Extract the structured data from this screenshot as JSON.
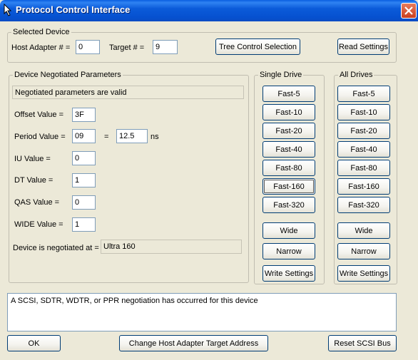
{
  "window": {
    "title": "Protocol Control Interface",
    "close_icon": "close-icon",
    "app_icon": "app-icon"
  },
  "selected_device": {
    "legend": "Selected Device",
    "host_adapter_label": "Host Adapter # =",
    "host_adapter_value": "0",
    "target_label": "Target # =",
    "target_value": "9",
    "tree_control_button": "Tree Control Selection",
    "read_settings_button": "Read Settings"
  },
  "negotiated": {
    "legend": "Device Negotiated Parameters",
    "status": "Negotiated parameters are valid",
    "offset_label": "Offset Value =",
    "offset_value": "3F",
    "period_label": "Period Value =",
    "period_value": "09",
    "period_equals": "=",
    "period_ns_value": "12.5",
    "period_unit": "ns",
    "iu_label": "IU Value =",
    "iu_value": "0",
    "dt_label": "DT Value =",
    "dt_value": "1",
    "qas_label": "QAS Value =",
    "qas_value": "0",
    "wide_label": "WIDE Value =",
    "wide_value": "1",
    "negotiated_at_label": "Device is negotiated at =",
    "negotiated_at_value": "Ultra 160"
  },
  "single_drive": {
    "legend": "Single Drive",
    "speeds": [
      "Fast-5",
      "Fast-10",
      "Fast-20",
      "Fast-40",
      "Fast-80",
      "Fast-160",
      "Fast-320"
    ],
    "wide": "Wide",
    "narrow": "Narrow",
    "write": "Write Settings"
  },
  "all_drives": {
    "legend": "All Drives",
    "speeds": [
      "Fast-5",
      "Fast-10",
      "Fast-20",
      "Fast-40",
      "Fast-80",
      "Fast-160",
      "Fast-320"
    ],
    "wide": "Wide",
    "narrow": "Narrow",
    "write": "Write Settings"
  },
  "status_message": "A SCSI, SDTR, WDTR, or PPR negotiation has occurred for this device",
  "footer": {
    "ok": "OK",
    "change_target": "Change Host Adapter Target Address",
    "reset_bus": "Reset SCSI Bus"
  }
}
